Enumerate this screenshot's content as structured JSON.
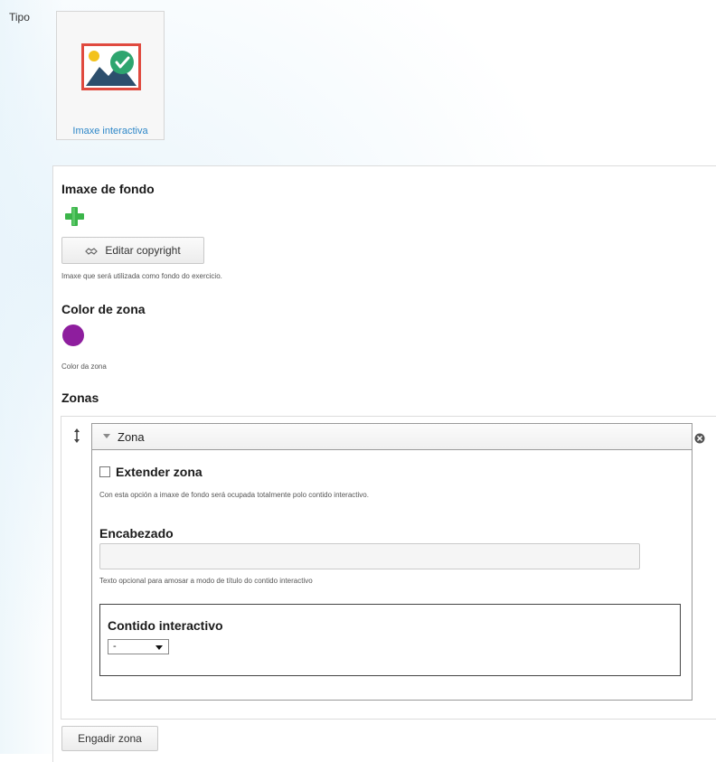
{
  "tipo": {
    "label": "Tipo",
    "card_label": "Imaxe interactiva"
  },
  "background_image": {
    "title": "Imaxe de fondo",
    "copyright_button": "Editar copyright",
    "description": "Imaxe que será utilizada como fondo do exercicio."
  },
  "zone_color": {
    "title": "Color de zona",
    "value": "#8e1e9e",
    "description": "Color da zona"
  },
  "zones": {
    "title": "Zonas",
    "items": [
      {
        "header": "Zona",
        "extend_label": "Extender zona",
        "extend_checked": false,
        "extend_description": "Con esta opción a imaxe de fondo será ocupada totalmente polo contido interactivo.",
        "heading_title": "Encabezado",
        "heading_value": "",
        "heading_description": "Texto opcional para amosar a modo de título do contido interactivo",
        "content_title": "Contido interactivo",
        "content_selected": "-"
      }
    ],
    "add_button": "Engadir zona"
  },
  "icons": {
    "card": "image-check-icon",
    "add": "plus-icon",
    "copyright": "handshake-icon",
    "drag": "drag-handle-icon",
    "remove": "close-circle-icon",
    "collapse": "caret-down-icon",
    "select": "dropdown-arrow-icon"
  },
  "colors": {
    "link": "#2e87c8",
    "plus": "#3bb54a",
    "zone_swatch": "#8e1e9e",
    "card_frame": "#e04a3f"
  }
}
